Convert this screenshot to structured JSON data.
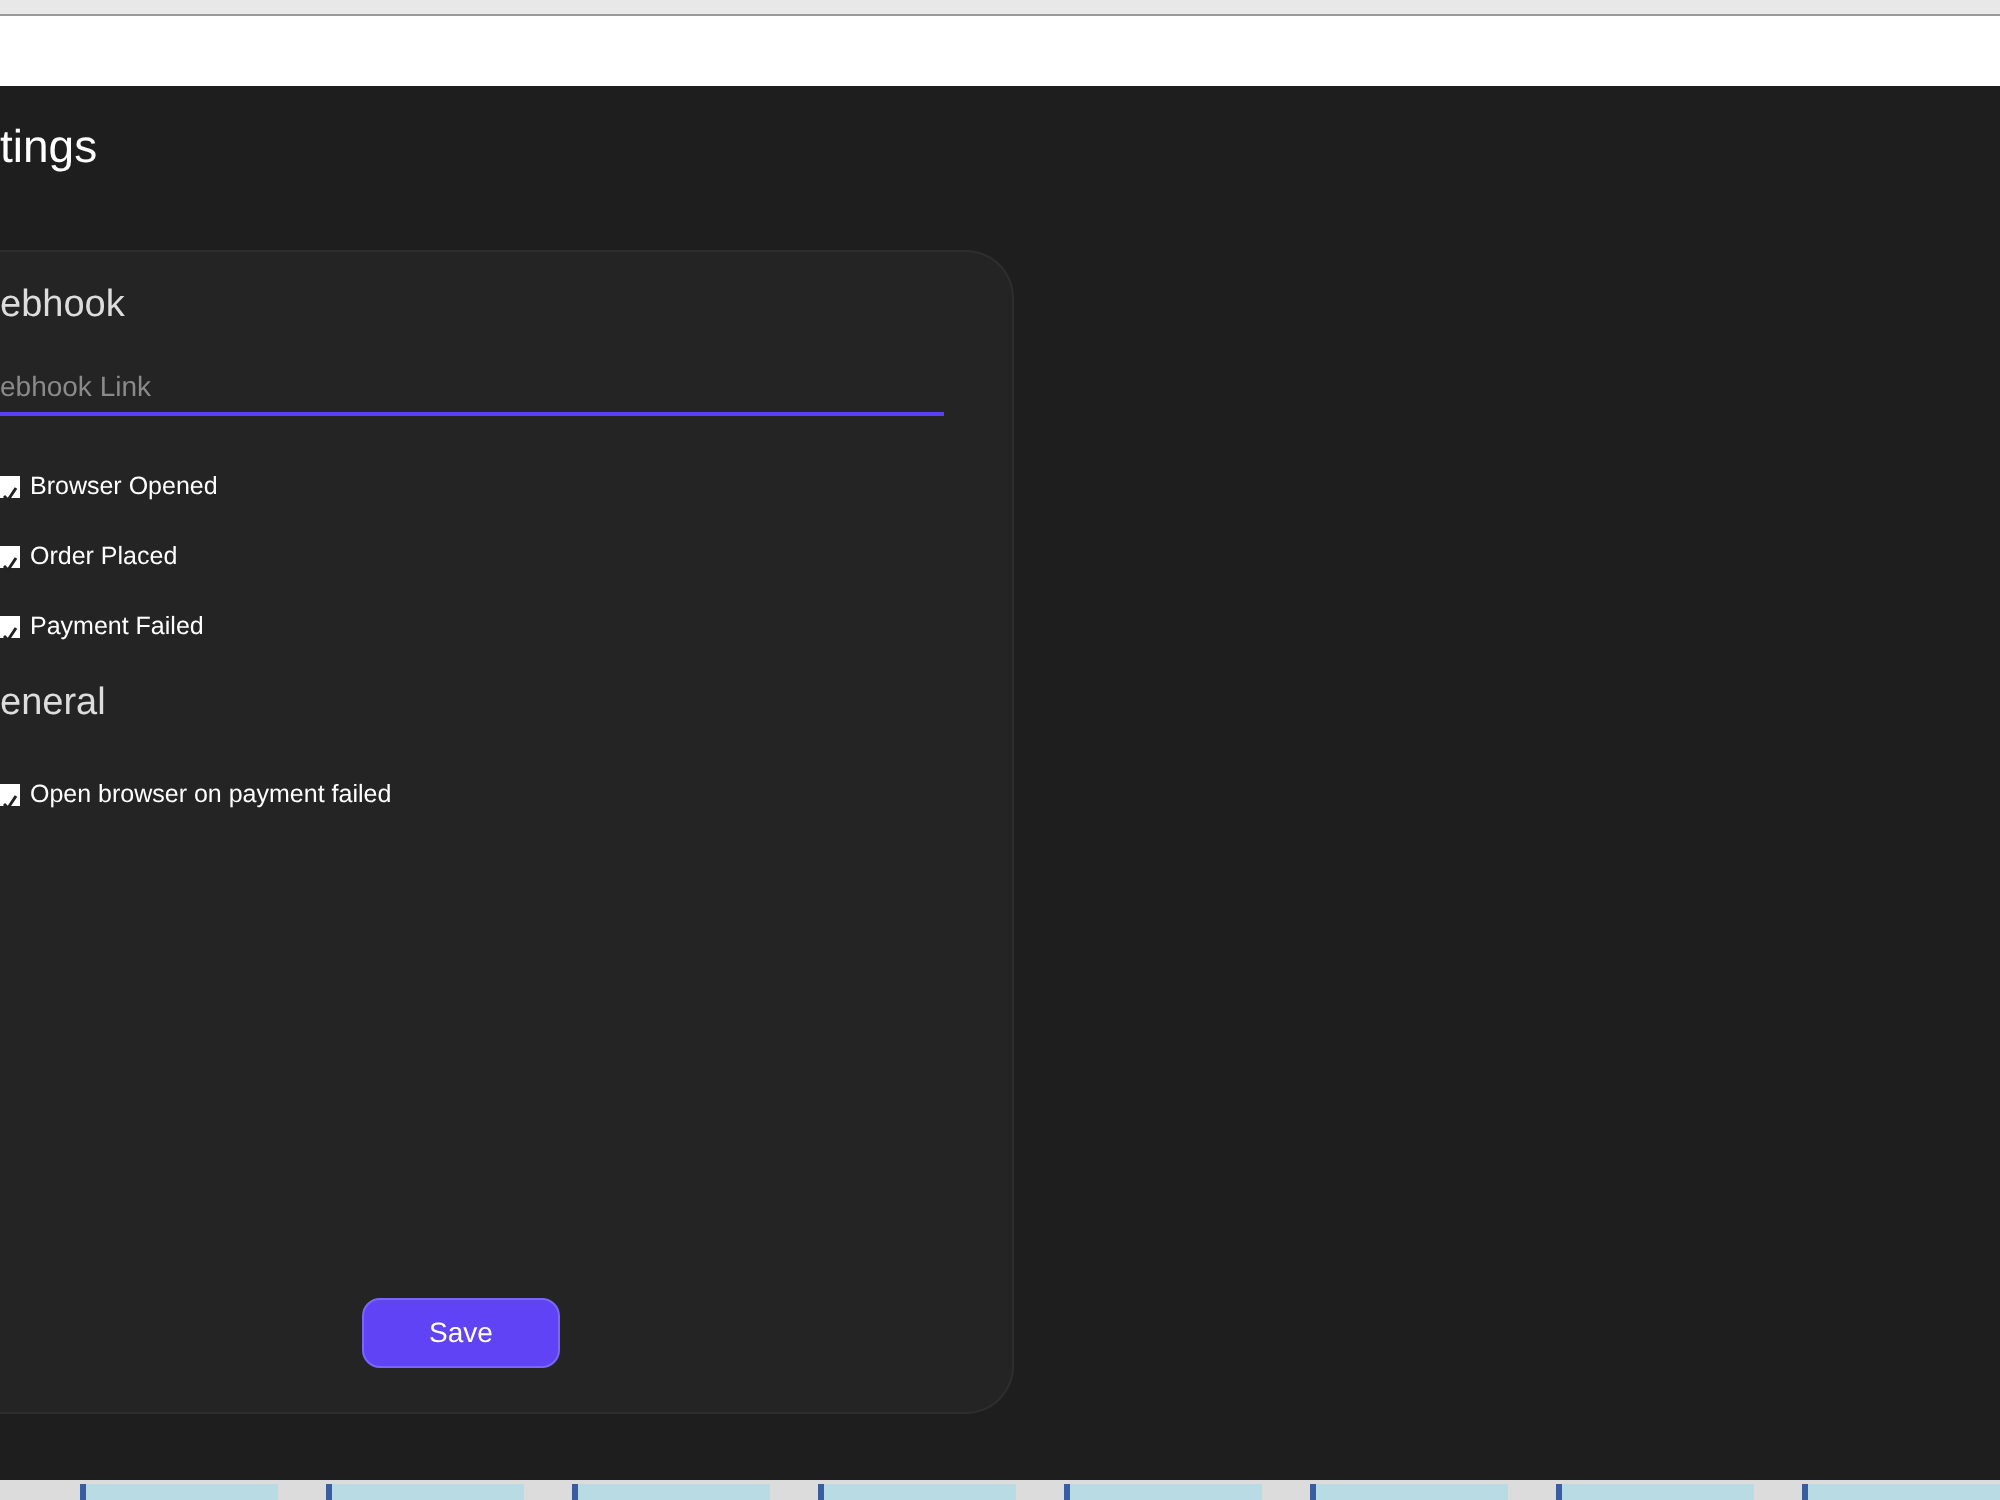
{
  "page_title": "tings",
  "sections": [
    {
      "heading": "ebhook",
      "field": {
        "placeholder": "ebhook Link"
      },
      "options": [
        {
          "label": "Browser Opened",
          "checked": true
        },
        {
          "label": "Order Placed",
          "checked": true
        },
        {
          "label": "Payment Failed",
          "checked": true
        }
      ]
    },
    {
      "heading": "eneral",
      "options": [
        {
          "label": "Open browser on payment failed",
          "checked": true
        }
      ]
    }
  ],
  "save_button": "Save"
}
